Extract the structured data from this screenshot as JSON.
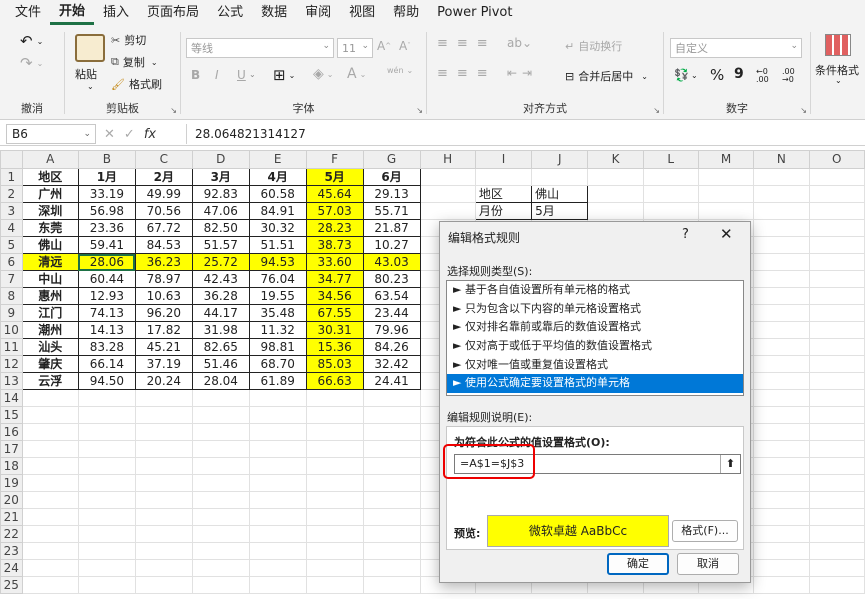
{
  "menu": [
    "文件",
    "开始",
    "插入",
    "页面布局",
    "公式",
    "数据",
    "审阅",
    "视图",
    "帮助",
    "Power Pivot"
  ],
  "ribbon": {
    "undo_group": "撤消",
    "clipboard": {
      "paste": "粘贴",
      "cut": "剪切",
      "copy": "复制",
      "format_painter": "格式刷",
      "label": "剪贴板"
    },
    "font": {
      "name": "等线",
      "size": "11",
      "bold": "B",
      "italic": "I",
      "underline": "U",
      "wen": "wén",
      "label": "字体"
    },
    "align": {
      "wrap": "自动换行",
      "merge": "合并后居中",
      "label": "对齐方式"
    },
    "number": {
      "format": "自定义",
      "percent": "%",
      "comma": "9",
      "label": "数字"
    },
    "styles": {
      "cond_format": "条件格式"
    }
  },
  "formula_bar": {
    "name_box": "B6",
    "value": "28.064821314127"
  },
  "columns": [
    "A",
    "B",
    "C",
    "D",
    "E",
    "F",
    "G",
    "H",
    "I",
    "J",
    "K",
    "L",
    "M",
    "N",
    "O"
  ],
  "table": {
    "headers": [
      "地区",
      "1月",
      "2月",
      "3月",
      "4月",
      "5月",
      "6月"
    ],
    "rows": [
      [
        "广州",
        "33.19",
        "49.99",
        "92.83",
        "60.58",
        "45.64",
        "29.13"
      ],
      [
        "深圳",
        "56.98",
        "70.56",
        "47.06",
        "84.91",
        "57.03",
        "55.71"
      ],
      [
        "东莞",
        "23.36",
        "67.72",
        "82.50",
        "30.32",
        "28.23",
        "21.87"
      ],
      [
        "佛山",
        "59.41",
        "84.53",
        "51.57",
        "51.51",
        "38.73",
        "10.27"
      ],
      [
        "清远",
        "28.06",
        "36.23",
        "25.72",
        "94.53",
        "33.60",
        "43.03"
      ],
      [
        "中山",
        "60.44",
        "78.97",
        "42.43",
        "76.04",
        "34.77",
        "80.23"
      ],
      [
        "惠州",
        "12.93",
        "10.63",
        "36.28",
        "19.55",
        "34.56",
        "63.54"
      ],
      [
        "江门",
        "74.13",
        "96.20",
        "44.17",
        "35.48",
        "67.55",
        "23.44"
      ],
      [
        "潮州",
        "14.13",
        "17.82",
        "31.98",
        "11.32",
        "30.31",
        "79.96"
      ],
      [
        "汕头",
        "83.28",
        "45.21",
        "82.65",
        "98.81",
        "15.36",
        "84.26"
      ],
      [
        "肇庆",
        "66.14",
        "37.19",
        "51.46",
        "68.70",
        "85.03",
        "32.42"
      ],
      [
        "云浮",
        "94.50",
        "20.24",
        "28.04",
        "61.89",
        "66.63",
        "24.41"
      ]
    ]
  },
  "lookup": [
    [
      "地区",
      "佛山"
    ],
    [
      "月份",
      "5月"
    ]
  ],
  "dialog": {
    "title": "编辑格式规则",
    "help": "?",
    "close": "✕",
    "select_type_label": "选择规则类型(S):",
    "rules": [
      "► 基于各自值设置所有单元格的格式",
      "► 只为包含以下内容的单元格设置格式",
      "► 仅对排名靠前或靠后的数值设置格式",
      "► 仅对高于或低于平均值的数值设置格式",
      "► 仅对唯一值或重复值设置格式",
      "► 使用公式确定要设置格式的单元格"
    ],
    "edit_desc_label": "编辑规则说明(E):",
    "formula_label": "为符合此公式的值设置格式(O):",
    "formula": "=A$1=$J$3",
    "preview_label": "预览:",
    "preview_text": "微软卓越  AaBbCc",
    "format_button": "格式(F)...",
    "ok": "确定",
    "cancel": "取消"
  }
}
